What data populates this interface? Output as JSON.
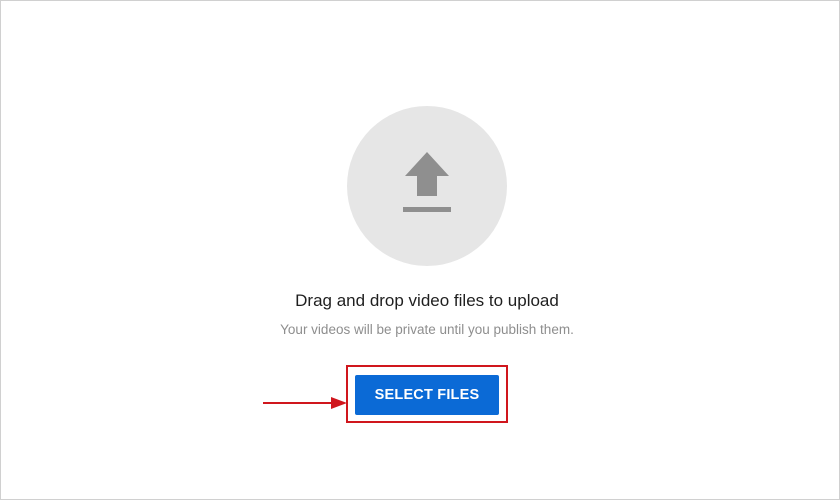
{
  "upload": {
    "icon": "upload-arrow-icon",
    "title": "Drag and drop video files to upload",
    "subtitle": "Your videos will be private until you publish them.",
    "select_button_label": "SELECT FILES"
  },
  "annotation": {
    "arrow": "right-arrow-icon",
    "highlight_color": "#d0161d"
  },
  "colors": {
    "accent": "#0b6ad6",
    "circle": "#e6e6e6",
    "icon": "#8f8f8f"
  }
}
